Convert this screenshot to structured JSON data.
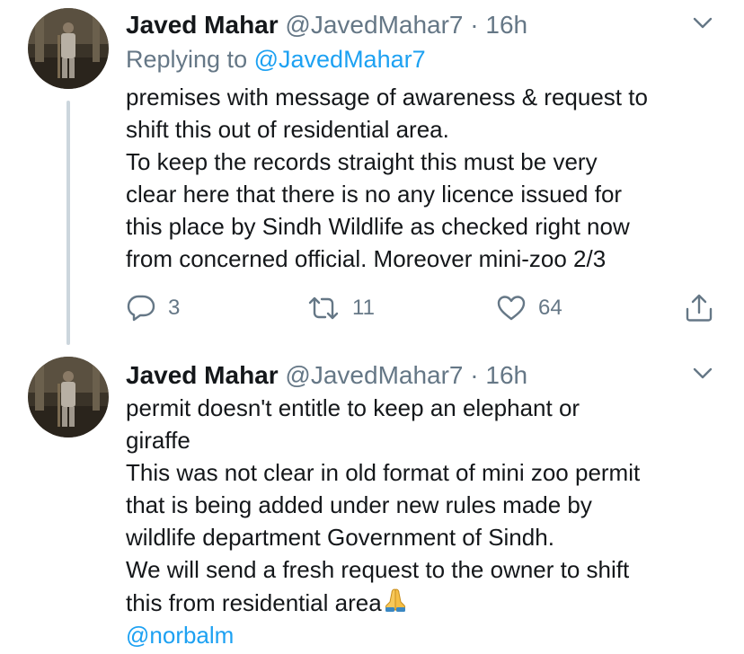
{
  "tweets": [
    {
      "author_name": "Javed Mahar",
      "handle": "@JavedMahar7",
      "separator": "·",
      "time": "16h",
      "replying_prefix": "Replying to",
      "replying_to": "@JavedMahar7",
      "lines": [
        "premises with message of awareness & request to",
        "shift this out of residential area.",
        "To keep the records straight this must be very",
        "clear here that there is no any licence issued for",
        "this place by Sindh Wildlife as checked right now",
        "from concerned official. Moreover mini-zoo  2/3"
      ],
      "actions": {
        "reply_count": "3",
        "retweet_count": "11",
        "like_count": "64"
      }
    },
    {
      "author_name": "Javed Mahar",
      "handle": "@JavedMahar7",
      "separator": "·",
      "time": "16h",
      "lines": [
        "permit doesn't entitle to keep an elephant or",
        "giraffe",
        "This was not clear in old format of mini zoo permit",
        "that is being added under new rules made by",
        "wildlife department Government of Sindh.",
        "We will send a fresh request to the owner to shift",
        "this from residential area"
      ],
      "mention": "@norbalm"
    }
  ],
  "icons": {
    "caret": "chevron-down-icon",
    "reply": "reply-icon",
    "retweet": "retweet-icon",
    "like": "heart-icon",
    "share": "share-icon",
    "emoji": "folded-hands-emoji"
  },
  "colors": {
    "text": "#14171a",
    "secondary": "#657786",
    "link": "#1da1f2",
    "thread_line": "#ccd6dd"
  }
}
